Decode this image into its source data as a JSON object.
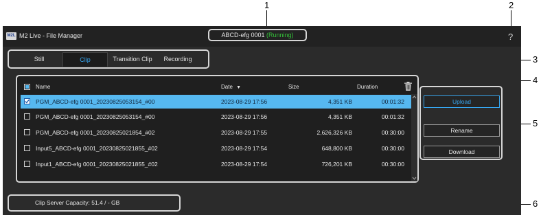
{
  "callouts": [
    "1",
    "2",
    "3",
    "4",
    "5",
    "6"
  ],
  "app": {
    "logo_text": "M2L",
    "title": "M2 Live - File Manager",
    "server_name": "ABCD-efg 0001",
    "server_status": "(Running)",
    "help_icon": "?"
  },
  "tabs": [
    {
      "label": "Still",
      "active": false
    },
    {
      "label": "Clip",
      "active": true
    },
    {
      "label": "Transition Clip",
      "active": false
    },
    {
      "label": "Recording",
      "active": false
    }
  ],
  "table": {
    "columns": {
      "name": "Name",
      "date": "Date",
      "size": "Size",
      "duration": "Duration"
    },
    "sort_indicator": "▼",
    "rows": [
      {
        "name": "PGM_ABCD-efg 0001_20230825053154_#00",
        "date": "2023-08-29 17:56",
        "size": "4,351 KB",
        "duration": "00:01:32",
        "checked": true
      },
      {
        "name": "PGM_ABCD-efg 0001_20230825053154_#00",
        "date": "2023-08-29 17:56",
        "size": "4,351 KB",
        "duration": "00:01:32",
        "checked": false
      },
      {
        "name": "PGM_ABCD-efg 0001_20230825021854_#02",
        "date": "2023-08-29 17:55",
        "size": "2,626,326 KB",
        "duration": "00:30:00",
        "checked": false
      },
      {
        "name": "Input5_ABCD-efg 0001_20230825021855_#02",
        "date": "2023-08-29 17:54",
        "size": "648,800 KB",
        "duration": "00:30:00",
        "checked": false
      },
      {
        "name": "Input1_ABCD-efg 0001_20230825021855_#02",
        "date": "2023-08-29 17:54",
        "size": "726,201 KB",
        "duration": "00:30:00",
        "checked": false
      }
    ]
  },
  "buttons": {
    "upload": "Upload",
    "rename": "Rename",
    "download": "Download"
  },
  "capacity": "Clip Server Capacity: 51.4 / - GB",
  "colors": {
    "accent": "#36a6f0",
    "selected_row": "#56b8f0",
    "running": "#35c23a",
    "background": "#2b2b2b"
  }
}
